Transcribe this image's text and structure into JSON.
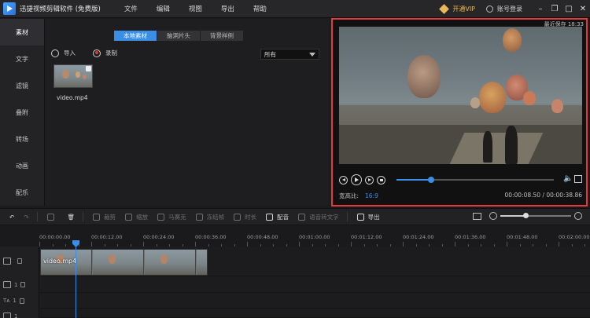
{
  "app": {
    "title": "迅捷视频剪辑软件 (免费版)",
    "menu": [
      "文件",
      "编辑",
      "视图",
      "导出",
      "帮助"
    ],
    "vip_label": "开通VIP",
    "login_label": "账号登录",
    "window_controls": [
      "minimize-icon",
      "restore-icon",
      "maximize-icon",
      "close-icon"
    ]
  },
  "sidebar": {
    "items": [
      {
        "label": "素材",
        "active": true
      },
      {
        "label": "文字",
        "active": false
      },
      {
        "label": "滤镜",
        "active": false
      },
      {
        "label": "叠附",
        "active": false
      },
      {
        "label": "转场",
        "active": false
      },
      {
        "label": "动画",
        "active": false
      },
      {
        "label": "配乐",
        "active": false
      }
    ]
  },
  "media": {
    "tabs": [
      {
        "label": "本地素材",
        "active": true
      },
      {
        "label": "脑洞片头",
        "active": false
      },
      {
        "label": "背景样例",
        "active": false
      }
    ],
    "import_label": "导入",
    "record_label": "录制",
    "filter_value": "所有",
    "items": [
      {
        "name": "video.mp4"
      }
    ]
  },
  "preview": {
    "autosave": "最近保存 18:33",
    "aspect_label": "宽高比:",
    "aspect_value": "16:9",
    "timecode": "00:00:08.50 / 00:00:38.86",
    "progress": 0.22
  },
  "toolbar": {
    "tools": [
      {
        "name": "undo-button",
        "label": "",
        "enabled": true
      },
      {
        "name": "redo-button",
        "label": "",
        "enabled": false
      },
      {
        "name": "edit-button",
        "label": "",
        "enabled": false
      },
      {
        "name": "delete-button",
        "label": "",
        "enabled": true
      },
      {
        "name": "crop-button",
        "label": "裁剪",
        "enabled": false
      },
      {
        "name": "zoom-button",
        "label": "缩放",
        "enabled": false
      },
      {
        "name": "mosaic-button",
        "label": "马赛克",
        "enabled": false
      },
      {
        "name": "freeze-button",
        "label": "冻结帧",
        "enabled": false
      },
      {
        "name": "duration-button",
        "label": "时长",
        "enabled": false
      },
      {
        "name": "voiceover-button",
        "label": "配音",
        "enabled": true
      },
      {
        "name": "speech-to-text-button",
        "label": "语音转文字",
        "enabled": false
      },
      {
        "name": "export-button",
        "label": "导出",
        "enabled": true
      }
    ],
    "zoom_level": 0.35
  },
  "timeline": {
    "ruler": [
      "00:00:00.00",
      "00:00:12.00",
      "00:00:24.00",
      "00:00:36.00",
      "00:00:48.00",
      "00:01:00.00",
      "00:01:12.00",
      "00:01:24.00",
      "00:01:36.00",
      "00:01:48.00",
      "00:02:00.00"
    ],
    "clip_label": "video.mp4",
    "track_numbers": [
      "1",
      "1",
      "1"
    ]
  }
}
